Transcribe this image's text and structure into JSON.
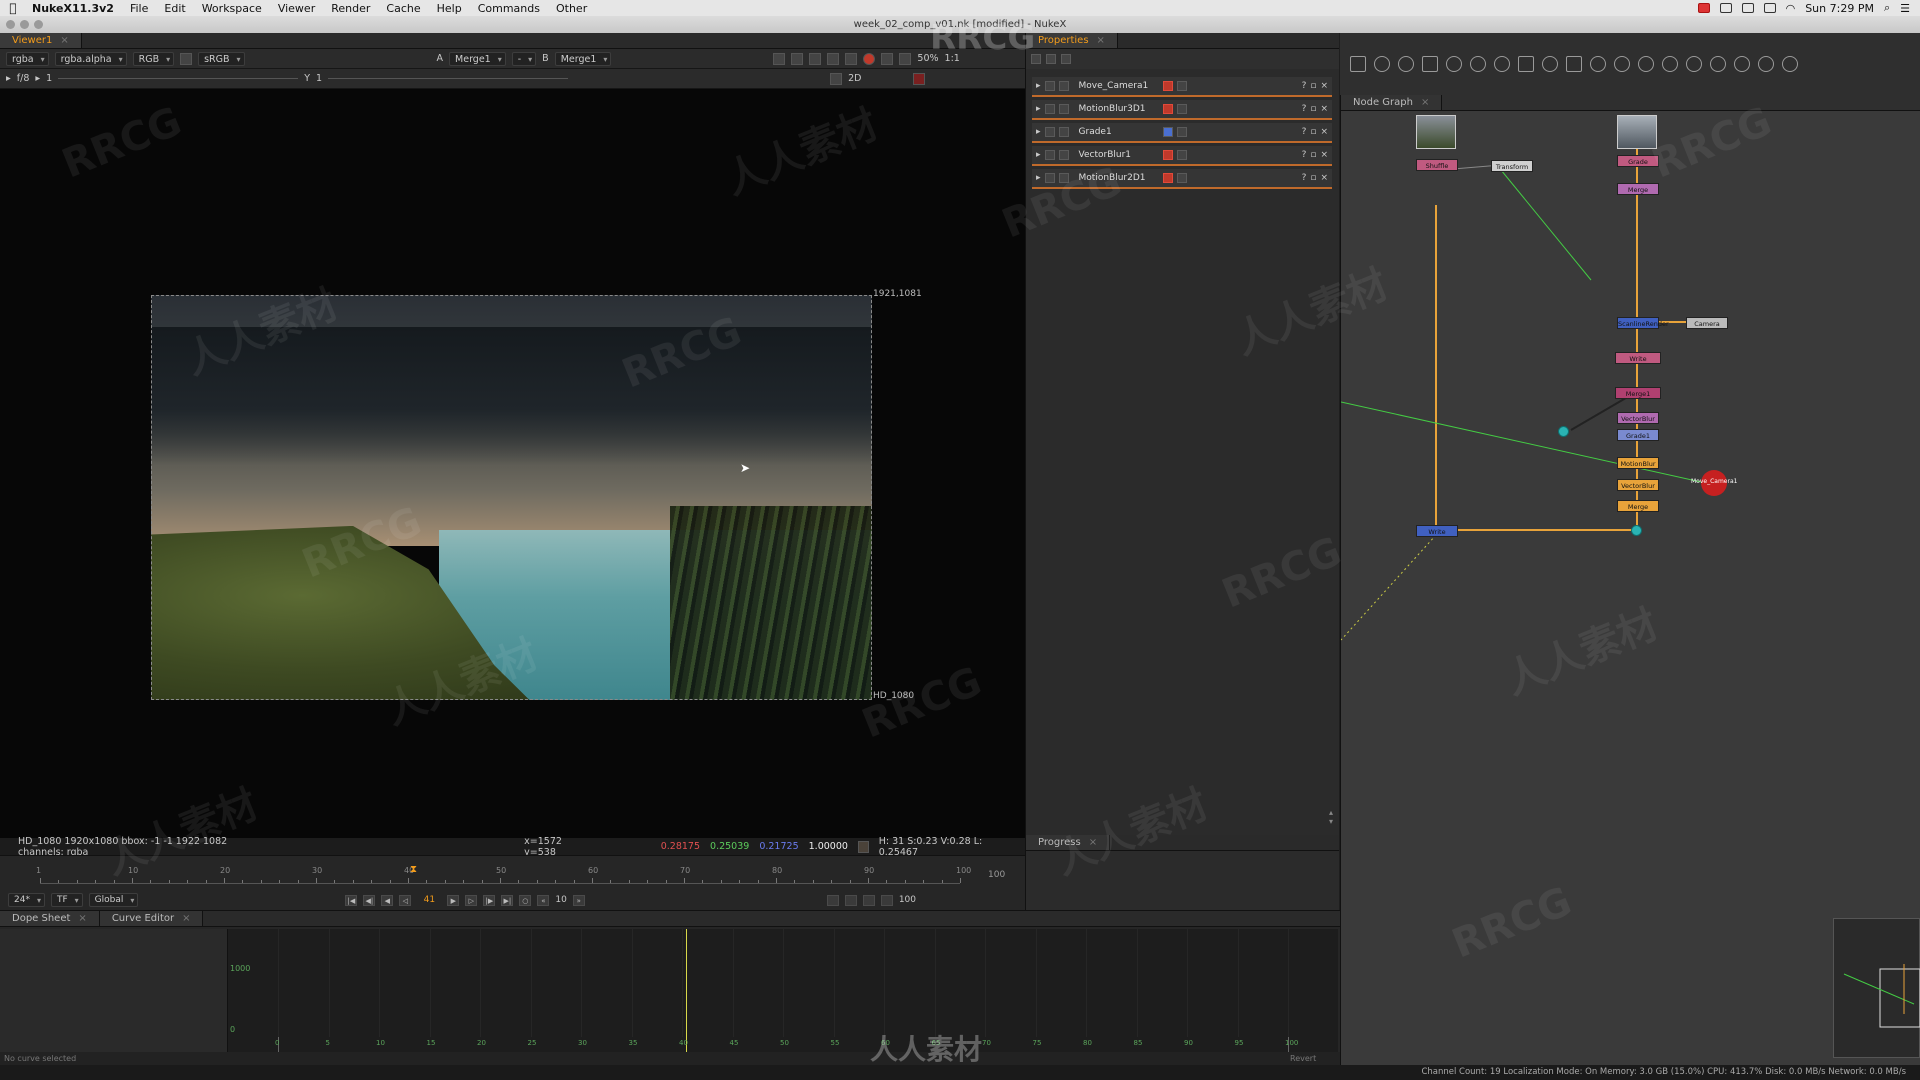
{
  "menubar": {
    "app_name": "NukeX11.3v2",
    "items": [
      "File",
      "Edit",
      "Workspace",
      "Viewer",
      "Render",
      "Cache",
      "Help",
      "Commands",
      "Other"
    ],
    "clock": "Sun 7:29 PM"
  },
  "window": {
    "title": "week_02_comp_v01.nk [modified] - NukeX"
  },
  "viewer": {
    "tab": "Viewer1",
    "channels": "rgba",
    "alpha": "rgba.alpha",
    "display": "RGB",
    "lut": "sRGB",
    "input_a_label": "A",
    "input_a": "Merge1",
    "input_b_label": "B",
    "input_b": "Merge1",
    "zoom": "50%",
    "ratio": "1:1",
    "mode": "2D",
    "fstop": "f/8",
    "gain": "1",
    "gamma_label": "Y",
    "gamma": "1",
    "corner_label": "1921,1081",
    "format_label": "HD_1080"
  },
  "infobar": {
    "format": "HD_1080 1920x1080  bbox: -1 -1 1922 1082 channels: rgba",
    "coords": "x=1572 y=538",
    "r": "0.28175",
    "g": "0.25039",
    "b": "0.21725",
    "a": "1.00000",
    "hsvl": "H: 31 S:0.23 V:0.28  L: 0.25467"
  },
  "timeline": {
    "ticks": [
      "1",
      "10",
      "20",
      "30",
      "40",
      "50",
      "60",
      "70",
      "80",
      "90",
      "100"
    ],
    "end_frame": "100",
    "fps": "24*",
    "tf": "TF",
    "range": "Global",
    "current_frame": "41",
    "step": "10",
    "out_frame": "100"
  },
  "properties": {
    "tab": "Properties",
    "nodes": [
      "Move_Camera1",
      "MotionBlur3D1",
      "Grade1",
      "VectorBlur1",
      "MotionBlur2D1"
    ],
    "progress_tab": "Progress"
  },
  "nodegraph": {
    "tab": "Node Graph",
    "nodes": [
      "Read",
      "Read",
      "Shuffle",
      "Transform",
      "Grade",
      "Merge",
      "ScanlineRender",
      "Camera",
      "Write",
      "Merge1",
      "VectorBlur",
      "Move_Camera1",
      "Grade1",
      "MotionBlur"
    ]
  },
  "dopesheet": {
    "tabs": [
      "Dope Sheet",
      "Curve Editor"
    ],
    "y_labels": [
      "1000",
      "0"
    ],
    "ticks": [
      "0",
      "5",
      "10",
      "15",
      "20",
      "25",
      "30",
      "35",
      "40",
      "45",
      "50",
      "55",
      "60",
      "65",
      "70",
      "75",
      "80",
      "85",
      "90",
      "95",
      "100"
    ],
    "no_curve": "No curve selected",
    "revert": "Revert"
  },
  "statusbar": {
    "text": "Channel Count: 19  Localization Mode: On  Memory: 3.0 GB (15.0%)  CPU: 413.7%  Disk: 0.0 MB/s  Network: 0.0 MB/s"
  },
  "watermark": {
    "text_en": "RRCG",
    "text_cn": "人人素材"
  },
  "colors": {
    "accent": "#f39c1b",
    "node_orange": "#e8a33a",
    "bg": "#1e1e1e"
  }
}
